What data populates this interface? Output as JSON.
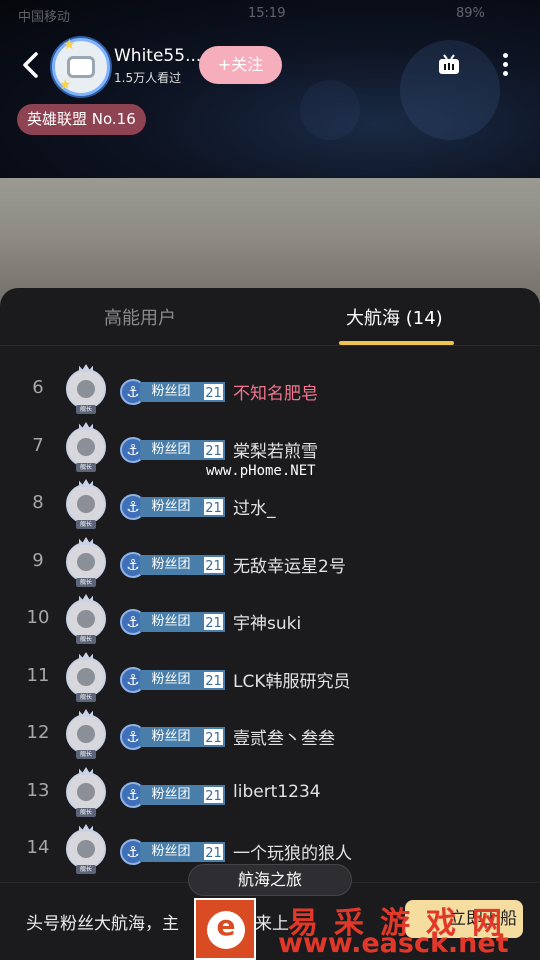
{
  "status_bar": {
    "carrier": "中国移动",
    "time": "15:19",
    "battery": "89%"
  },
  "header": {
    "anchor_name": "White55...",
    "views": "1.5万人看过",
    "follow_label": "+关注",
    "area_tag": "英雄联盟 No.16"
  },
  "tabs": [
    {
      "label": "高能用户",
      "active": false
    },
    {
      "label": "大航海 (14)",
      "active": true
    }
  ],
  "badge": {
    "anchor_symbol": "⚓",
    "label": "粉丝团",
    "level": "21",
    "avatar_tag": "舰长"
  },
  "list": [
    {
      "rank": "6",
      "name": "不知名肥皂",
      "highlight": true
    },
    {
      "rank": "7",
      "name": "棠梨若煎雪",
      "highlight": false
    },
    {
      "rank": "8",
      "name": "过水_",
      "highlight": false
    },
    {
      "rank": "9",
      "name": "无敌幸运星2号",
      "highlight": false
    },
    {
      "rank": "10",
      "name": "宇神suki",
      "highlight": false
    },
    {
      "rank": "11",
      "name": "LCK韩服研究员",
      "highlight": false
    },
    {
      "rank": "12",
      "name": "壹贰叁丶叁叁",
      "highlight": false
    },
    {
      "rank": "13",
      "name": "libert1234",
      "highlight": false
    },
    {
      "rank": "14",
      "name": "一个玩狼的狼人",
      "highlight": false
    }
  ],
  "watermark_phome": "www.pHome.NET",
  "bottom": {
    "text": "头号粉丝大航海，主",
    "text_tail": "来上",
    "voyage_tip": "航海之旅",
    "board_label": "立即上船"
  },
  "watermark_easck": {
    "logo_letter": "e",
    "title": "易采游戏网",
    "url": "www.easck.net"
  },
  "colors": {
    "accent_gold": "#f0c34f",
    "follow_pink": "#f7aebc",
    "highlight_name": "#f2748f",
    "area_tag_bg": "#8e4352",
    "board_btn": "#f5dda0"
  }
}
